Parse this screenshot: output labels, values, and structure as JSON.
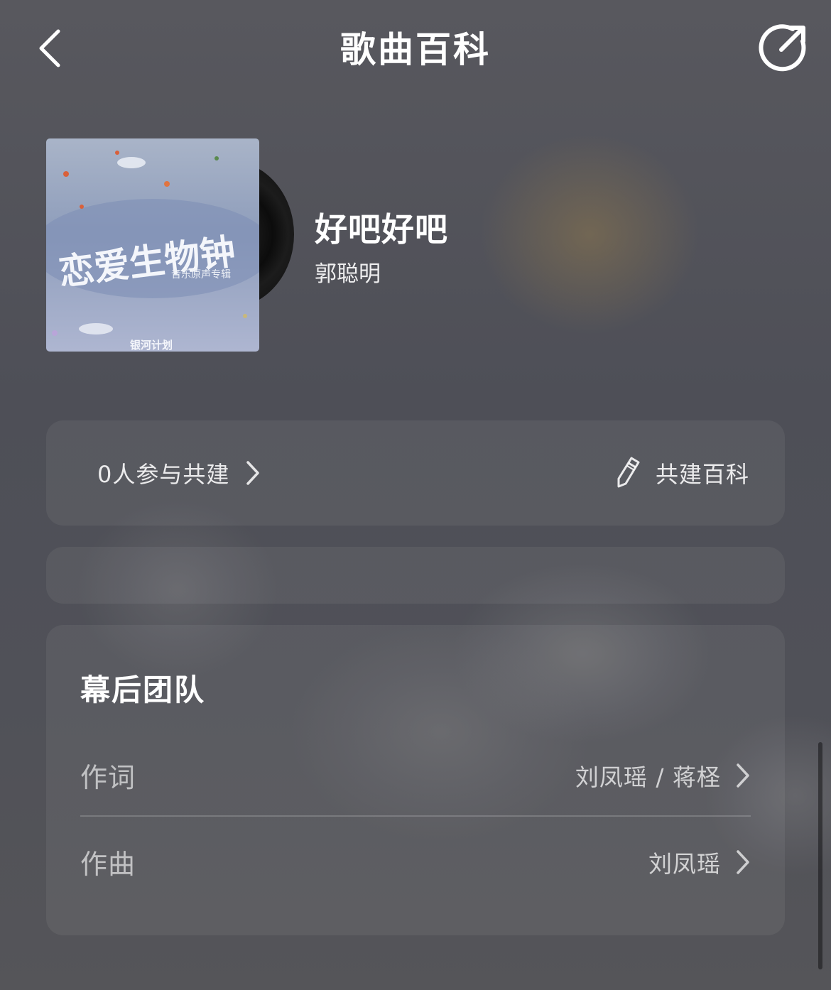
{
  "header": {
    "title": "歌曲百科",
    "back_icon": "chevron-left-icon",
    "share_icon": "share-icon"
  },
  "song": {
    "title": "好吧好吧",
    "artist": "郭聪明",
    "album_art_text": [
      "恋爱生物钟",
      "音乐原声专辑",
      "银河计划"
    ]
  },
  "contribution": {
    "participants_text": "0人参与共建",
    "edit_label": "共建百科",
    "edit_icon": "pencil-icon"
  },
  "team": {
    "heading": "幕后团队",
    "rows": [
      {
        "label": "作词",
        "value": "刘凤瑶 / 蒋柽"
      },
      {
        "label": "作曲",
        "value": "刘凤瑶"
      }
    ]
  },
  "colors": {
    "background": "#505158",
    "card": "rgba(255,255,255,0.06)",
    "text_primary": "#ffffff"
  }
}
